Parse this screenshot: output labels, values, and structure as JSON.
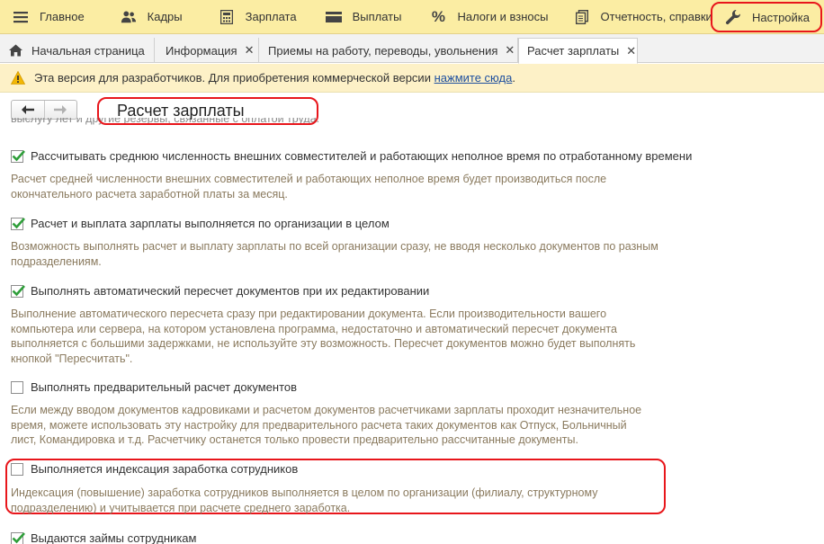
{
  "menu": {
    "items": [
      {
        "label": "Главное",
        "icon": "hamburger-icon"
      },
      {
        "label": "Кадры",
        "icon": "people-icon"
      },
      {
        "label": "Зарплата",
        "icon": "calculator-icon"
      },
      {
        "label": "Выплаты",
        "icon": "wallet-icon"
      },
      {
        "label": "Налоги и взносы",
        "icon": "percent-icon"
      },
      {
        "label": "Отчетность, справки",
        "icon": "reports-icon"
      },
      {
        "label": "Настройка",
        "icon": "wrench-icon"
      }
    ]
  },
  "tabs": [
    {
      "label": "Начальная страница",
      "icon": "home-icon"
    },
    {
      "label": "Информация"
    },
    {
      "label": "Приемы на работу, переводы, увольнения"
    },
    {
      "label": "Расчет зарплаты"
    }
  ],
  "notice": {
    "text": "Эта версия для разработчиков. Для приобретения коммерческой версии ",
    "link": "нажмите сюда",
    "suffix": "."
  },
  "page": {
    "title": "Расчет зарплаты",
    "cut_text": "выслугу лет и другие резервы, связанные с оплатой труда."
  },
  "options": [
    {
      "label": "Рассчитывать среднюю численность внешних совместителей и работающих неполное время по отработанному времени",
      "checked": true,
      "desc": [
        "Расчет средней численности внешних совместителей и работающих неполное время будет производиться после",
        "окончательного расчета заработной платы за месяц."
      ]
    },
    {
      "label": "Расчет и выплата зарплаты выполняется по организации в целом",
      "checked": true,
      "desc": [
        "Возможность выполнять расчет и выплату зарплаты по всей организации сразу, не вводя несколько документов по разным",
        "подразделениям."
      ]
    },
    {
      "label": "Выполнять автоматический пересчет документов при их редактировании",
      "checked": true,
      "desc": [
        "Выполнение автоматического пересчета сразу при редактировании документа. Если производительности вашего",
        "компьютера или сервера, на котором установлена программа, недостаточно и автоматический пересчет документа",
        "выполняется с большими задержками, не используйте эту возможность. Пересчет документов можно будет выполнять",
        "кнопкой \"Пересчитать\"."
      ]
    },
    {
      "label": "Выполнять предварительный расчет документов",
      "checked": false,
      "desc": [
        "Если между вводом документов кадровиками и расчетом документов расчетчиками зарплаты проходит незначительное",
        "время, можете использовать эту настройку для предварительного расчета таких документов как Отпуск, Больничный",
        "лист, Командировка и т.д. Расчетчику останется только провести предварительно рассчитанные документы."
      ]
    },
    {
      "label": "Выполняется индексация заработка сотрудников",
      "checked": false,
      "desc": [
        "Индексация (повышение) заработка сотрудников выполняется в целом по организации (филиалу, структурному",
        "подразделению) и учитывается при расчете среднего заработка."
      ]
    },
    {
      "label": "Выдаются займы сотрудникам",
      "checked": true,
      "desc": []
    }
  ]
}
